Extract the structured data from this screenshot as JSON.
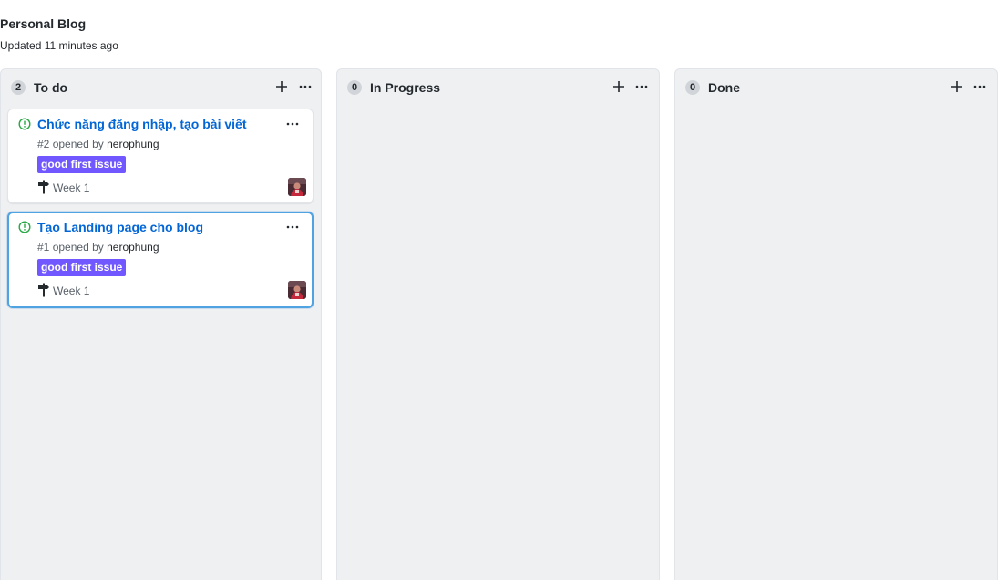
{
  "project": {
    "title": "Personal Blog",
    "updated_prefix": "Updated",
    "updated_time": "11 minutes ago"
  },
  "columns": [
    {
      "name": "To do",
      "count": "2",
      "cards": [
        {
          "title": "Chức năng đăng nhập, tạo bài viết",
          "number": "#2",
          "opened_by": "opened by",
          "author": "nerophung",
          "label": "good first issue",
          "label_color": "#7057ff",
          "milestone": "Week 1"
        },
        {
          "title": "Tạo Landing page cho blog",
          "number": "#1",
          "opened_by": "opened by",
          "author": "nerophung",
          "label": "good first issue",
          "label_color": "#7057ff",
          "milestone": "Week 1"
        }
      ]
    },
    {
      "name": "In Progress",
      "count": "0",
      "cards": []
    },
    {
      "name": "Done",
      "count": "0",
      "cards": []
    }
  ],
  "colors": {
    "link": "#0366d6",
    "open_issue": "#28a745",
    "column_bg": "#eff0f2",
    "selected_border": "#4fa3e0"
  },
  "icons": {
    "issue": "issue-opened-icon",
    "add": "plus-icon",
    "more": "kebab-horizontal-icon",
    "milestone": "milestone-icon"
  }
}
